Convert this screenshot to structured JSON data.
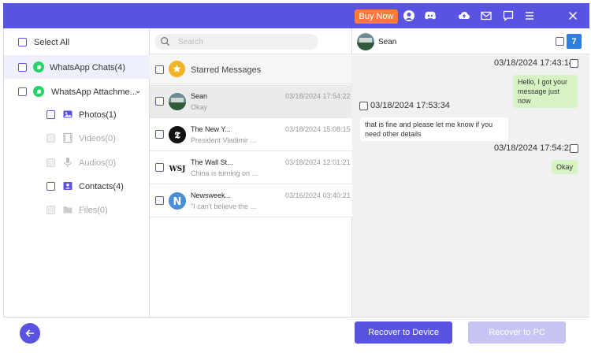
{
  "header": {
    "buy_now": "Buy Now",
    "icons": [
      "user-icon",
      "discord-icon",
      "cloud-upload-icon",
      "mail-icon",
      "feedback-icon",
      "menu-icon",
      "close-icon"
    ],
    "accent": "#5a52e0",
    "buy_color": "#ff7a3c"
  },
  "sidebar": {
    "select_all": "Select All",
    "items": [
      {
        "label": "WhatsApp Chats(4)"
      },
      {
        "label": "WhatsApp Attachme..."
      }
    ],
    "attachments": [
      {
        "label": "Photos(1)",
        "enabled": true
      },
      {
        "label": "Videos(0)",
        "enabled": false
      },
      {
        "label": "Audios(0)",
        "enabled": false
      },
      {
        "label": "Contacts(4)",
        "enabled": true
      },
      {
        "label": "Files(0)",
        "enabled": false
      }
    ]
  },
  "list": {
    "search_placeholder": "Search",
    "starred": "Starred Messages",
    "messages": [
      {
        "name": "Sean",
        "preview": "Okay",
        "time": "03/18/2024 17:54:22",
        "icon": "sean-avatar"
      },
      {
        "name": "The New Y...",
        "preview": "President Vladimir ...",
        "time": "03/18/2024 15:08:15",
        "icon": "nyt-logo"
      },
      {
        "name": "The Wall St...",
        "preview": "China is turning on ...",
        "time": "03/18/2024 12:01:21",
        "icon": "wsj-logo"
      },
      {
        "name": "Newsweek...",
        "preview": "\"I can't believe the ...",
        "time": "03/16/2024 03:40:21",
        "icon": "newsweek-logo"
      }
    ]
  },
  "chat": {
    "contact": "Sean",
    "calendar_day": "7",
    "messages": [
      {
        "time": "03/18/2024 17:43:14",
        "text": "Hello, I got your message just now",
        "direction": "out"
      },
      {
        "time": "03/18/2024 17:53:34",
        "text": "that is fine and please let me know if you need other details",
        "direction": "in"
      },
      {
        "time": "03/18/2024 17:54:22",
        "text": "Okay",
        "direction": "out"
      }
    ]
  },
  "footer": {
    "recover_device": "Recover to Device",
    "recover_pc": "Recover to PC"
  }
}
